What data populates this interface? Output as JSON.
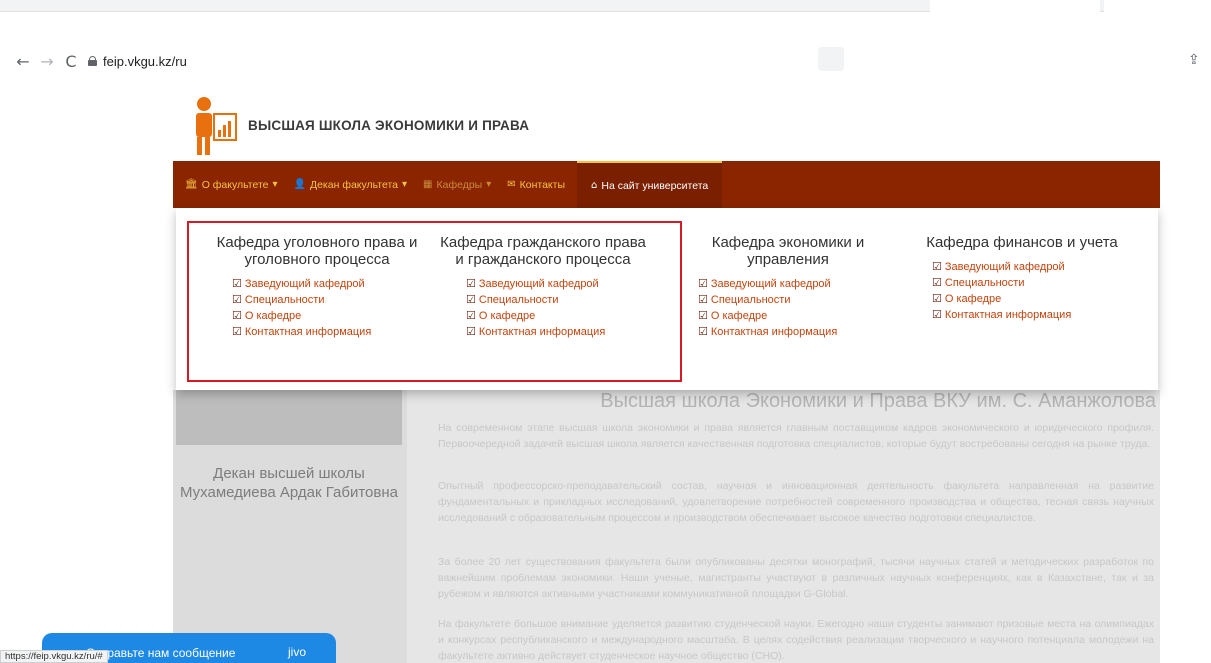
{
  "browser": {
    "url": "feip.vkgu.kz/ru",
    "status_url": "https://feip.vkgu.kz/ru/#"
  },
  "site": {
    "title": "ВЫСШАЯ ШКОЛА ЭКОНОМИКИ И ПРАВА"
  },
  "navbar": {
    "items": [
      {
        "label": "О факультете",
        "icon": "university-icon",
        "dropdown": true
      },
      {
        "label": "Декан факультета",
        "icon": "user-icon",
        "dropdown": true
      },
      {
        "label": "Кафедры",
        "icon": "grid-icon",
        "dropdown": true
      },
      {
        "label": "Контакты",
        "icon": "envelope-icon",
        "dropdown": false
      },
      {
        "label": "На сайт университета",
        "icon": "home-icon",
        "dropdown": false
      }
    ]
  },
  "dropdown": {
    "columns": [
      {
        "title": "Кафедра уголовного права и уголовного процесса",
        "links": [
          "Заведующий кафедрой",
          "Специальности",
          "О кафедре",
          "Контактная информация"
        ]
      },
      {
        "title": "Кафедра гражданского права и гражданского процесса",
        "links": [
          "Заведующий кафедрой",
          "Специальности",
          "О кафедре",
          "Контактная информация"
        ]
      },
      {
        "title": "Кафедра экономики и управления",
        "links": [
          "Заведующий кафедрой",
          "Специальности",
          "О кафедре",
          "Контактная информация"
        ]
      },
      {
        "title": "Кафедра финансов и учета",
        "links": [
          "Заведующий кафедрой",
          "Специальности",
          "О кафедре",
          "Контактная информация"
        ]
      }
    ]
  },
  "sidebar": {
    "dean_label": "Декан высшей школы Мухамедиева Ардак Габитовна"
  },
  "main": {
    "heading": "Высшая школа Экономики и Права ВКУ им. С. Аманжолова",
    "paragraphs": [
      "На современном этапе высшая школа экономики и права является главным поставщиком кадров экономического и юридического профиля. Первоочередной задачей высшая школа является качественная подготовка специалистов, которые будут востребованы сегодня на рынке труда.",
      "Опытный профессорско-преподавательский состав, научная и инновационная деятельность факультета направленная на развитие фундаментальных и прикладных исследований, удовлетворение потребностей современного производства и общества, тесная связь научных исследований с образовательным процессом и производством обеспечивает высокое качество подготовки специалистов.",
      "За более 20 лет существования факультета были опубликованы десятки монографий, тысячи научных статей и методических разработок по важнейшим проблемам экономики. Наши ученые, магистранты участвуют в различных научных конференциях, как в Казахстане, так и за рубежом и являются активными участниками коммуникативной площадки G-Global.",
      "На факультете большое внимание уделяется развитию студенческой науки. Ежегодно наши студенты занимают призовые места на олимпиадах и конкурсах республиканского и международного масштаба. В целях содействия реализации творческого и научного потенциала молодежи на факультете активно действует студенческое научное общество (СНО)."
    ]
  },
  "chat": {
    "label": "Отправьте нам сообщение",
    "brand": "jivo"
  }
}
